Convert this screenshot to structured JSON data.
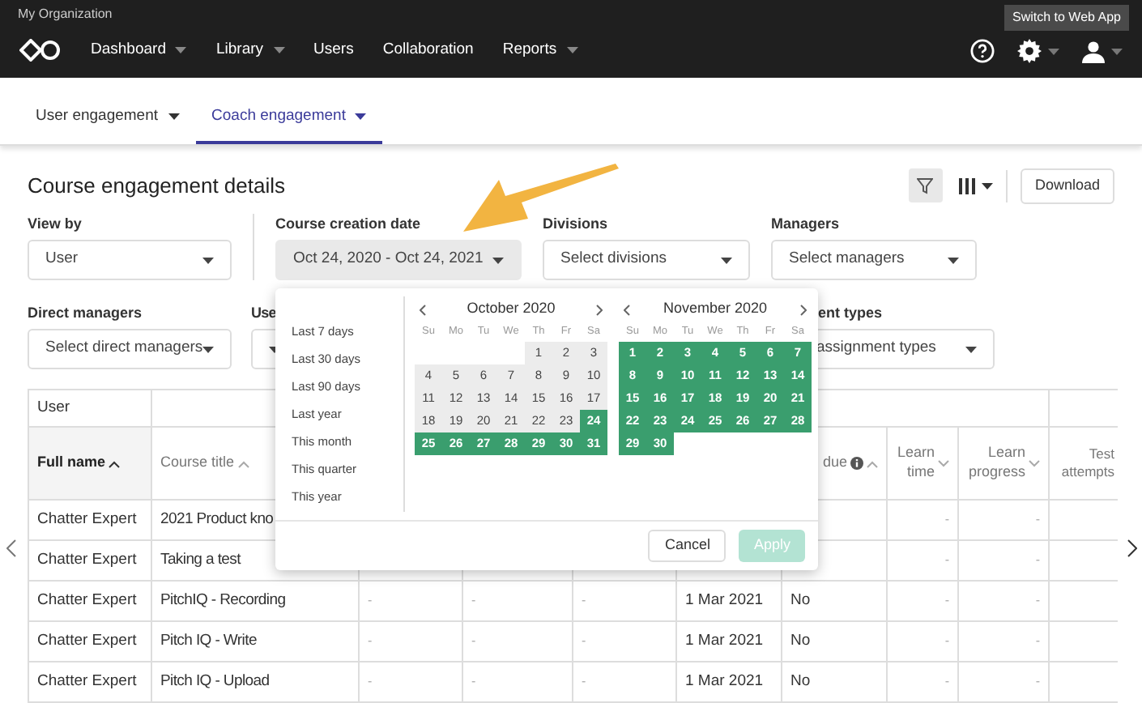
{
  "header": {
    "org": "My Organization",
    "switch_button": "Switch to Web App",
    "nav": [
      {
        "label": "Dashboard",
        "dropdown": true
      },
      {
        "label": "Library",
        "dropdown": true
      },
      {
        "label": "Users",
        "dropdown": false
      },
      {
        "label": "Collaboration",
        "dropdown": false
      },
      {
        "label": "Reports",
        "dropdown": true
      }
    ]
  },
  "tabs": [
    {
      "label": "User engagement",
      "selected": false
    },
    {
      "label": "Coach engagement",
      "selected": true
    }
  ],
  "title": "Course engagement details",
  "toolbar": {
    "filter_active": true,
    "download": "Download"
  },
  "filters_row1": [
    {
      "label": "View by",
      "value": "User",
      "active": false
    },
    {
      "label": "Course creation date",
      "value": "Oct 24, 2020 - Oct 24, 2021",
      "active": true
    },
    {
      "label": "Divisions",
      "value": "Select divisions",
      "active": false
    },
    {
      "label": "Managers",
      "value": "Select managers",
      "active": false
    }
  ],
  "filters_row2": [
    {
      "label": "Direct managers",
      "value": "Select direct managers"
    },
    {
      "label": "Use"
    },
    {
      "label": "ent types",
      "value": "assignment types"
    }
  ],
  "date_picker": {
    "presets": [
      "Last 7 days",
      "Last 30 days",
      "Last 90 days",
      "Last year",
      "This month",
      "This quarter",
      "This year"
    ],
    "months": [
      {
        "title": "October 2020",
        "weekdays": [
          "Su",
          "Mo",
          "Tu",
          "We",
          "Th",
          "Fr",
          "Sa"
        ],
        "weeks": [
          [
            {
              "day": "1",
              "in_range": false
            },
            {
              "day": "2",
              "in_range": false
            },
            {
              "day": "3",
              "in_range": false
            }
          ],
          [
            {
              "day": "4",
              "in_range": false
            },
            {
              "day": "5",
              "in_range": false
            },
            {
              "day": "6",
              "in_range": false
            },
            {
              "day": "7",
              "in_range": false
            },
            {
              "day": "8",
              "in_range": false
            },
            {
              "day": "9",
              "in_range": false
            },
            {
              "day": "10",
              "in_range": false
            }
          ],
          [
            {
              "day": "11",
              "in_range": false
            },
            {
              "day": "12",
              "in_range": false
            },
            {
              "day": "13",
              "in_range": false
            },
            {
              "day": "14",
              "in_range": false
            },
            {
              "day": "15",
              "in_range": false
            },
            {
              "day": "16",
              "in_range": false
            },
            {
              "day": "17",
              "in_range": false
            }
          ],
          [
            {
              "day": "18",
              "in_range": false
            },
            {
              "day": "19",
              "in_range": false
            },
            {
              "day": "20",
              "in_range": false
            },
            {
              "day": "21",
              "in_range": false
            },
            {
              "day": "22",
              "in_range": false
            },
            {
              "day": "23",
              "in_range": false
            },
            {
              "day": "24",
              "in_range": true
            }
          ],
          [
            {
              "day": "25",
              "in_range": true
            },
            {
              "day": "26",
              "in_range": true
            },
            {
              "day": "27",
              "in_range": true
            },
            {
              "day": "28",
              "in_range": true
            },
            {
              "day": "29",
              "in_range": true
            },
            {
              "day": "30",
              "in_range": true
            },
            {
              "day": "31",
              "in_range": true
            }
          ]
        ]
      },
      {
        "title": "November 2020",
        "weekdays": [
          "Su",
          "Mo",
          "Tu",
          "We",
          "Th",
          "Fr",
          "Sa"
        ],
        "weeks": [
          [
            {
              "day": "1",
              "in_range": true
            },
            {
              "day": "2",
              "in_range": true
            },
            {
              "day": "3",
              "in_range": true
            },
            {
              "day": "4",
              "in_range": true
            },
            {
              "day": "5",
              "in_range": true
            },
            {
              "day": "6",
              "in_range": true
            },
            {
              "day": "7",
              "in_range": true
            }
          ],
          [
            {
              "day": "8",
              "in_range": true
            },
            {
              "day": "9",
              "in_range": true
            },
            {
              "day": "10",
              "in_range": true
            },
            {
              "day": "11",
              "in_range": true
            },
            {
              "day": "12",
              "in_range": true
            },
            {
              "day": "13",
              "in_range": true
            },
            {
              "day": "14",
              "in_range": true
            }
          ],
          [
            {
              "day": "15",
              "in_range": true
            },
            {
              "day": "16",
              "in_range": true
            },
            {
              "day": "17",
              "in_range": true
            },
            {
              "day": "18",
              "in_range": true
            },
            {
              "day": "19",
              "in_range": true
            },
            {
              "day": "20",
              "in_range": true
            },
            {
              "day": "21",
              "in_range": true
            }
          ],
          [
            {
              "day": "22",
              "in_range": true
            },
            {
              "day": "23",
              "in_range": true
            },
            {
              "day": "24",
              "in_range": true
            },
            {
              "day": "25",
              "in_range": true
            },
            {
              "day": "26",
              "in_range": true
            },
            {
              "day": "27",
              "in_range": true
            },
            {
              "day": "28",
              "in_range": true
            }
          ],
          [
            {
              "day": "29",
              "in_range": true
            },
            {
              "day": "30",
              "in_range": true
            }
          ]
        ]
      }
    ],
    "cancel": {
      "label": "Cancel",
      "disabled": false
    },
    "apply": {
      "label": "Apply",
      "disabled": true
    }
  },
  "table": {
    "group_header": "User",
    "columns": [
      {
        "label": "Full name",
        "sort_ascending": true,
        "selected": true
      },
      {
        "label": "Course title",
        "sort_ascending": true,
        "selected": false
      },
      null,
      null,
      null,
      null,
      {
        "label": "due",
        "sort_ascending": true,
        "info": true,
        "selected": false
      },
      {
        "label": "Learn time",
        "sort_ascending": false,
        "selected": false
      },
      {
        "label": "Learn progress",
        "sort_ascending": false,
        "selected": false
      },
      {
        "label": "Test attempts",
        "selected": false
      }
    ],
    "rows": [
      {
        "cells": [
          "Chatter Expert",
          "2021 Product kno",
          null,
          null,
          null,
          null,
          null,
          "-",
          "-",
          null
        ]
      },
      {
        "cells": [
          "Chatter Expert",
          "Taking a test",
          null,
          null,
          null,
          null,
          null,
          "-",
          "-",
          null
        ]
      },
      {
        "cells": [
          "Chatter Expert",
          "PitchIQ - Recording",
          "-",
          "-",
          "-",
          "1 Mar 2021",
          "No",
          "-",
          "-",
          null
        ]
      },
      {
        "cells": [
          "Chatter Expert",
          "Pitch IQ - Write",
          "-",
          "-",
          "-",
          "1 Mar 2021",
          "No",
          "-",
          "-",
          null
        ]
      },
      {
        "cells": [
          "Chatter Expert",
          "Pitch IQ - Upload",
          "-",
          "-",
          "-",
          "1 Mar 2021",
          "No",
          "-",
          "-",
          null
        ]
      }
    ]
  }
}
